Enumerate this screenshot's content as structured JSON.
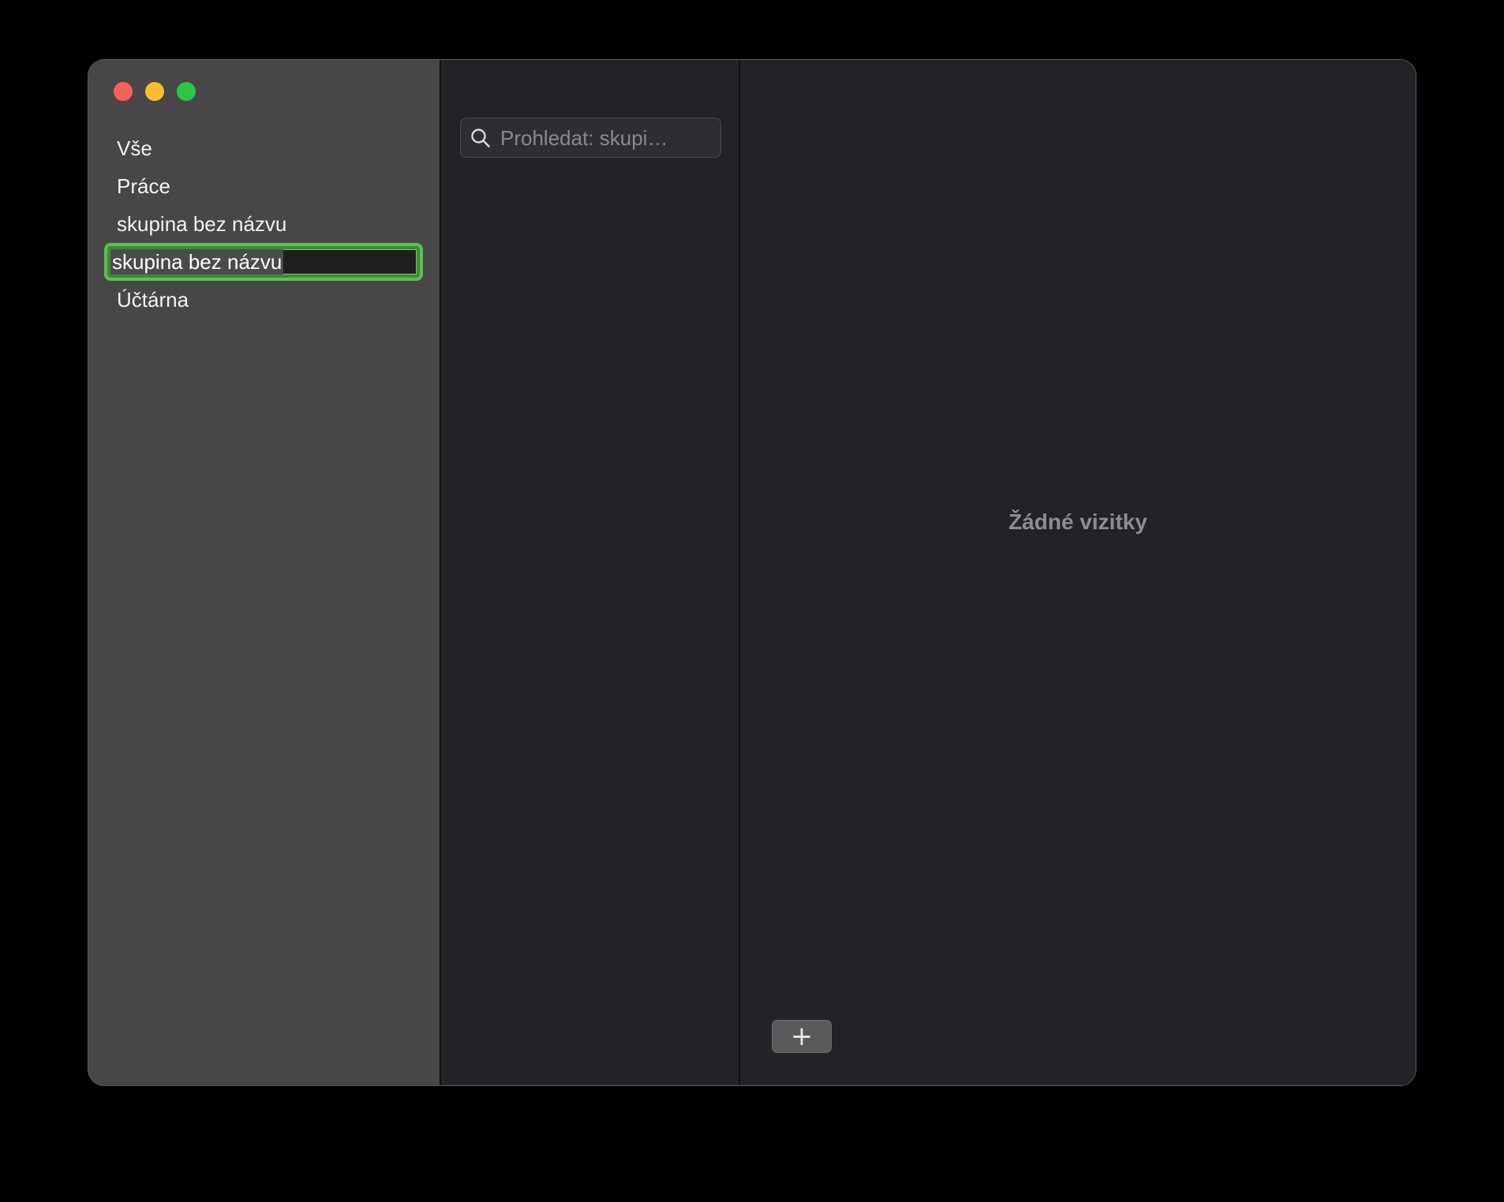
{
  "window": {
    "traffic_lights": [
      "close",
      "minimize",
      "maximize"
    ]
  },
  "sidebar": {
    "groups": [
      {
        "label": "Vše"
      },
      {
        "label": "Práce"
      },
      {
        "label": "skupina bez názvu"
      },
      {
        "label": "skupina bez názvu",
        "editing": true
      },
      {
        "label": "Účtárna"
      }
    ]
  },
  "list": {
    "search": {
      "placeholder": "Prohledat: skupi…",
      "value": ""
    }
  },
  "detail": {
    "empty_text": "Žádné vizitky",
    "add_label": "+"
  },
  "colors": {
    "accent_edit": "#5cbf52",
    "close": "#ff5f57",
    "minimize": "#febc2e",
    "maximize": "#28c840"
  }
}
